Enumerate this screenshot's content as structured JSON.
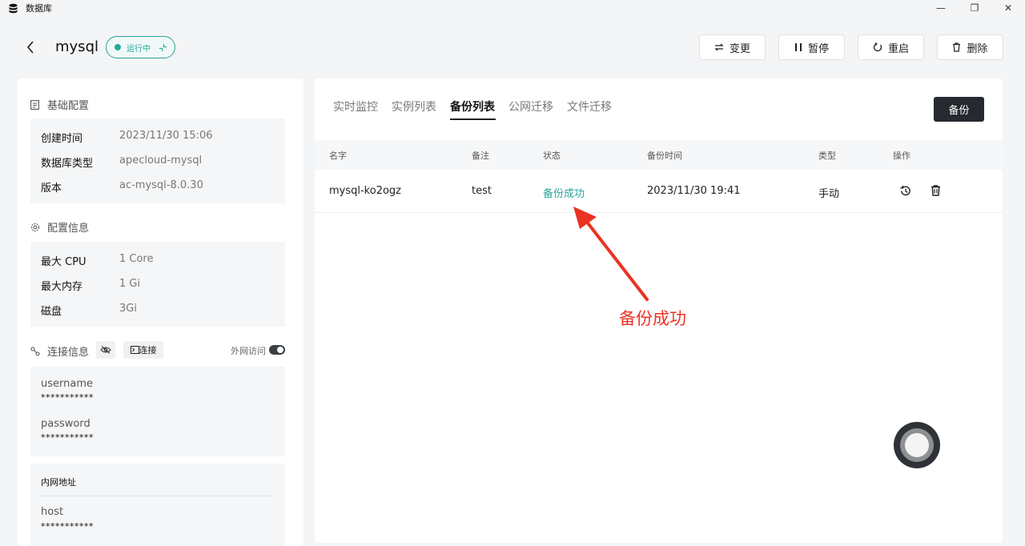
{
  "window": {
    "title": "数据库",
    "controls": {
      "minimize": "—",
      "maximize": "❐",
      "close": "✕"
    }
  },
  "header": {
    "db_name": "mysql",
    "status": "运行中",
    "buttons": {
      "change": "变更",
      "pause": "暂停",
      "restart": "重启",
      "delete": "删除"
    }
  },
  "basic": {
    "title": "基础配置",
    "rows": [
      {
        "key": "创建时间",
        "value": "2023/11/30 15:06"
      },
      {
        "key": "数据库类型",
        "value": "apecloud-mysql"
      },
      {
        "key": "版本",
        "value": "ac-mysql-8.0.30"
      }
    ]
  },
  "config": {
    "title": "配置信息",
    "rows": [
      {
        "key": "最大 CPU",
        "value": "1 Core"
      },
      {
        "key": "最大内存",
        "value": "1 Gi"
      },
      {
        "key": "磁盘",
        "value": "3Gi"
      }
    ]
  },
  "connection": {
    "title": "连接信息",
    "connect_label": "连接",
    "external_access_label": "外网访问",
    "external_access_on": true,
    "username_label": "username",
    "username_value": "***********",
    "password_label": "password",
    "password_value": "***********",
    "internal_title": "内网地址",
    "host_label": "host",
    "host_value": "***********"
  },
  "tabs": [
    {
      "label": "实时监控",
      "active": false
    },
    {
      "label": "实例列表",
      "active": false
    },
    {
      "label": "备份列表",
      "active": true
    },
    {
      "label": "公网迁移",
      "active": false
    },
    {
      "label": "文件迁移",
      "active": false
    }
  ],
  "backup_button": "备份",
  "table": {
    "columns": [
      "名字",
      "备注",
      "状态",
      "备份时间",
      "类型",
      "操作"
    ],
    "rows": [
      {
        "name": "mysql-ko2ogz",
        "note": "test",
        "status": "备份成功",
        "time": "2023/11/30 19:41",
        "type": "手动"
      }
    ]
  },
  "annotation": {
    "text": "备份成功",
    "color": "#ea3323"
  },
  "colors": {
    "accent": "#2ba59a",
    "dark_button": "#262a30"
  }
}
